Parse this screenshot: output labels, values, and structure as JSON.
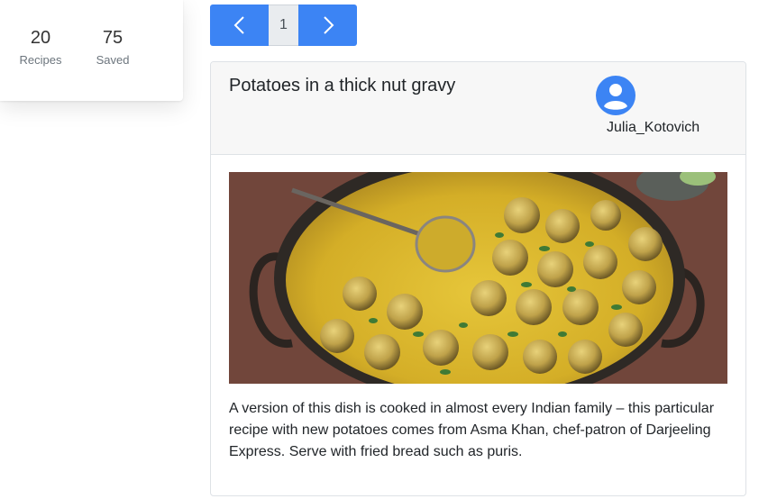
{
  "stats": {
    "recipes": {
      "value": "20",
      "label": "Recipes"
    },
    "saved": {
      "value": "75",
      "label": "Saved"
    }
  },
  "pagination": {
    "current_page": "1",
    "prev_icon": "chevron-left-icon",
    "next_icon": "chevron-right-icon"
  },
  "recipe": {
    "title": "Potatoes in a thick nut gravy",
    "author": "Julia_Kotovich",
    "author_icon": "account-circle-icon",
    "description": "A version of this dish is cooked in almost every Indian family – this particular recipe with new potatoes comes from Asma Khan, chef-patron of Darjeeling Express. Serve with fried bread such as puris."
  },
  "colors": {
    "accent": "#3c84f4",
    "next_button": "#3c84f4",
    "gravy": "#d8b52a"
  }
}
